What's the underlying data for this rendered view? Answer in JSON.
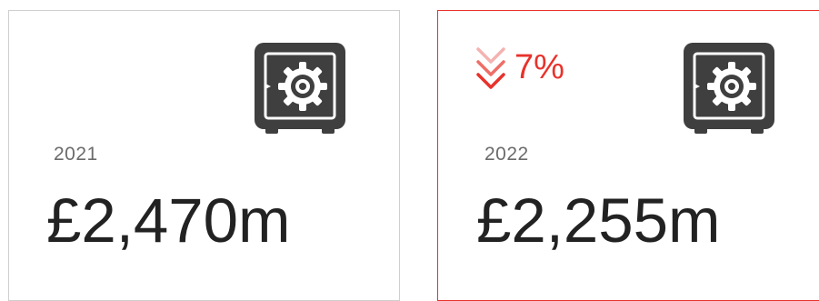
{
  "cards": [
    {
      "year": "2021",
      "amount": "£2,470m",
      "icon": "safe-icon"
    },
    {
      "year": "2022",
      "amount": "£2,255m",
      "icon": "safe-icon",
      "change": {
        "direction": "down",
        "icon": "double-chevron-down-icon",
        "value": "7%"
      }
    }
  ],
  "colors": {
    "accent_red": "#e8322b",
    "accent_red_light": "#f4b3b0",
    "icon_dark": "#3f3f3f",
    "card_border_neutral": "#cfcfcf",
    "year_text": "#6b6b6b",
    "amount_text": "#222222"
  }
}
